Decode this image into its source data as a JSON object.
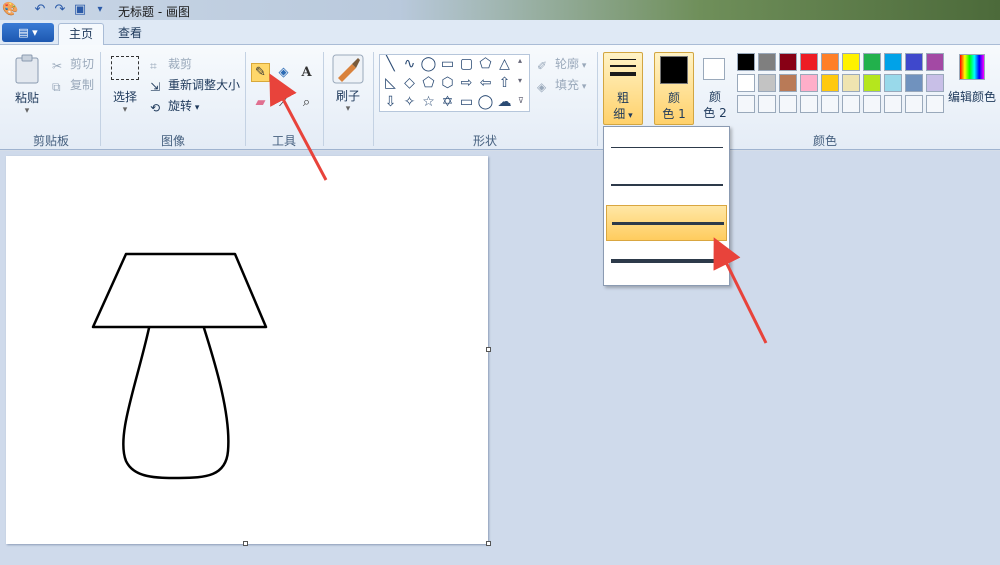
{
  "window": {
    "title": "无标题 - 画图"
  },
  "tabs": [
    {
      "label": "主页"
    },
    {
      "label": "查看"
    }
  ],
  "menu_button": {
    "label": "▤ ▾"
  },
  "clipboard": {
    "paste": "粘贴",
    "cut": "剪切",
    "copy": "复制",
    "group": "剪贴板"
  },
  "image": {
    "select": "选择",
    "crop": "裁剪",
    "resize": "重新调整大小",
    "rotate": "旋转",
    "group": "图像"
  },
  "tools": {
    "group": "工具",
    "active": "pencil"
  },
  "brushes": {
    "label": "刷子"
  },
  "shapes": {
    "outline": "轮廓",
    "fill": "填充",
    "group": "形状"
  },
  "size": {
    "label_line1": "粗",
    "label_line2": "细"
  },
  "color1": {
    "line1": "颜",
    "line2": "色 1",
    "value": "#000000"
  },
  "color2": {
    "line1": "颜",
    "line2": "色 2",
    "value": "#ffffff"
  },
  "colors": {
    "group": "颜色",
    "edit_label": "编辑颜色",
    "palette_row1": [
      "#000000",
      "#7f7f7f",
      "#880015",
      "#ed1c24",
      "#ff7f27",
      "#fff200",
      "#22b14c",
      "#00a2e8",
      "#3f48cc",
      "#a349a4"
    ],
    "palette_row2": [
      "#ffffff",
      "#c3c3c3",
      "#b97a57",
      "#ffaec9",
      "#ffc90e",
      "#efe4b0",
      "#b5e61d",
      "#99d9ea",
      "#7092be",
      "#c8bfe7"
    ]
  },
  "size_menu": {
    "options": [
      1,
      2,
      3,
      4
    ],
    "selected_index": 2
  }
}
